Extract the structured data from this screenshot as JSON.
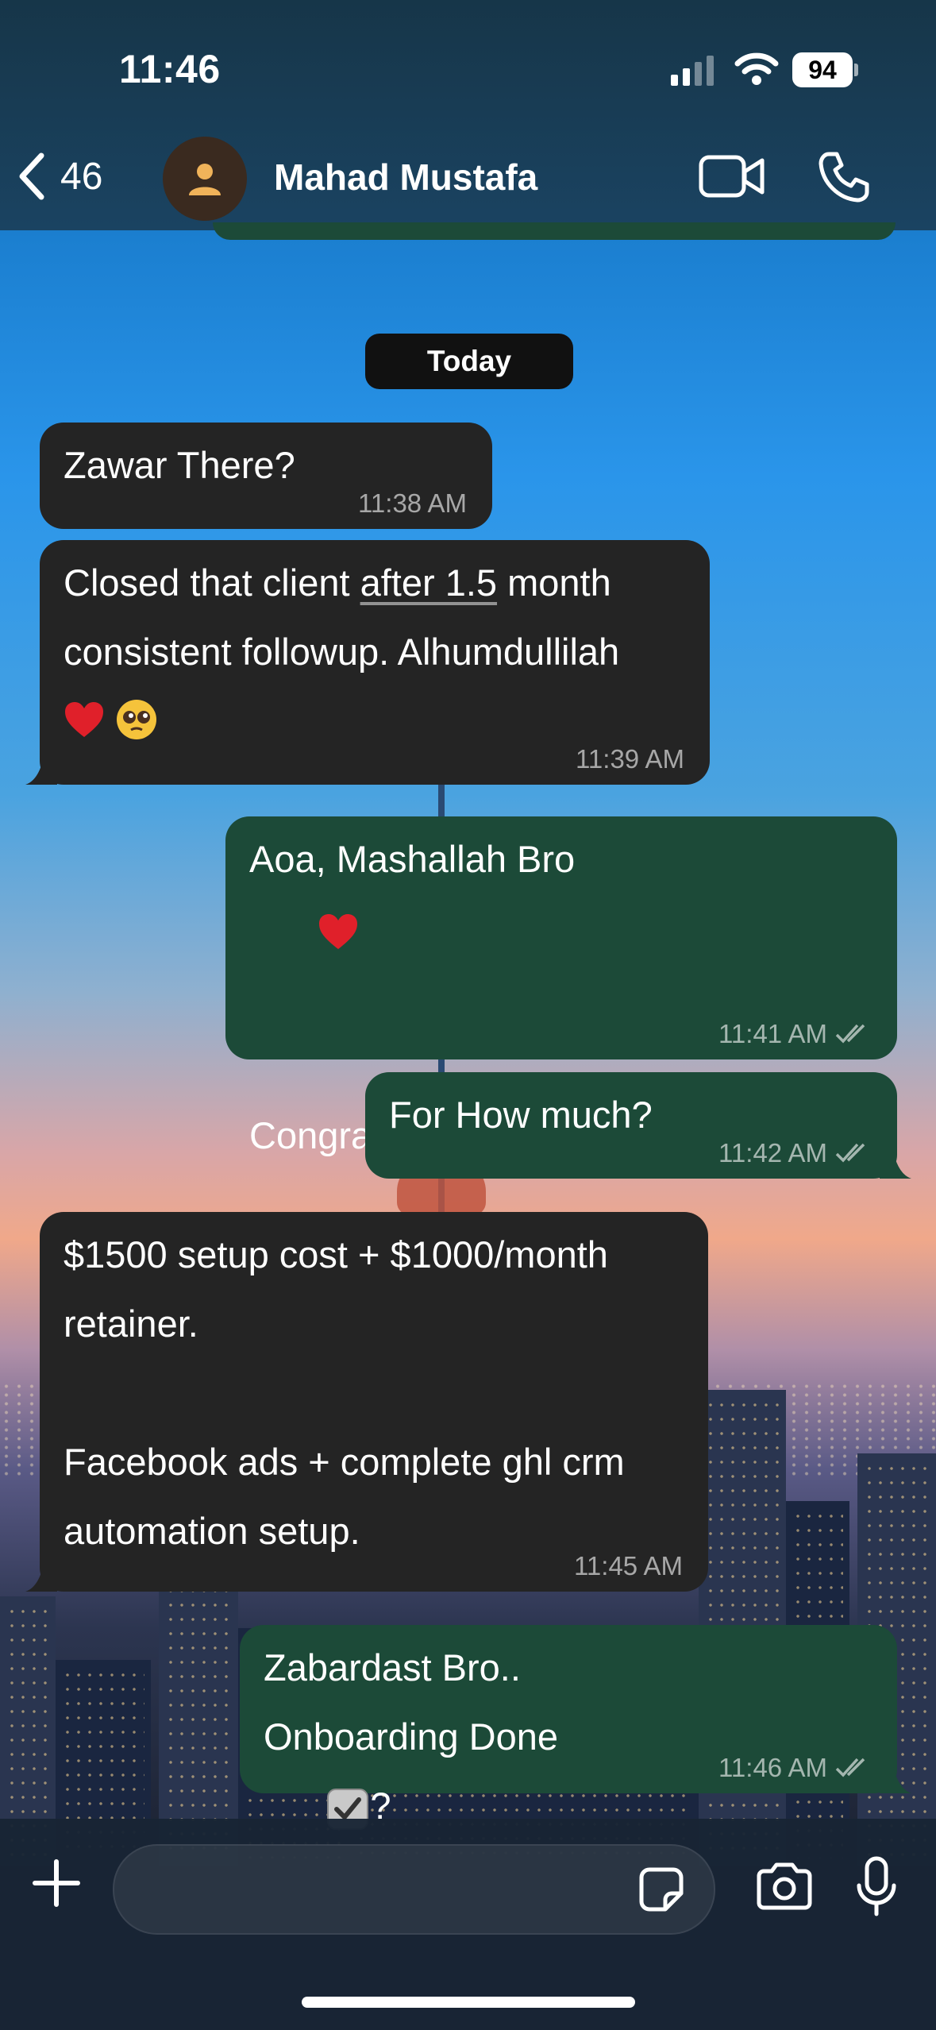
{
  "status_bar": {
    "time": "11:46",
    "battery": "94"
  },
  "header": {
    "back_count": "46",
    "contact_name": "Mahad Mustafa"
  },
  "date_separator": "Today",
  "messages": [
    {
      "direction": "in",
      "text": "Zawar There?",
      "time": "11:38 AM"
    },
    {
      "direction": "in",
      "text_before": "Closed that client ",
      "text_link": "after 1.5",
      "text_after": " month\nconsistent followup. Alhumdullilah",
      "emoji": "❤️🥹",
      "time": "11:39 AM"
    },
    {
      "direction": "out",
      "text": "Aoa, Mashallah Bro",
      "text2": "Congratulations. Finally",
      "time": "11:41 AM",
      "read": true
    },
    {
      "direction": "out",
      "text": "For How much?",
      "time": "11:42 AM",
      "read": true
    },
    {
      "direction": "in",
      "text": "$1500 setup cost + $1000/month\nretainer.\n\nFacebook ads + complete ghl crm\nautomation setup.",
      "time": "11:45 AM"
    },
    {
      "direction": "out",
      "text": "Zabardast Bro..",
      "text2": "Onboarding Done",
      "text2_suffix": "?",
      "time": "11:46 AM",
      "read": true
    }
  ],
  "colors": {
    "incoming_bubble": "#242424",
    "outgoing_bubble": "#1c4a38",
    "header_bg": "#163446"
  },
  "icons": [
    "back-chevron-icon",
    "person-icon",
    "video-call-icon",
    "phone-icon",
    "plus-icon",
    "sticker-icon",
    "camera-icon",
    "microphone-icon",
    "double-check-icon"
  ]
}
